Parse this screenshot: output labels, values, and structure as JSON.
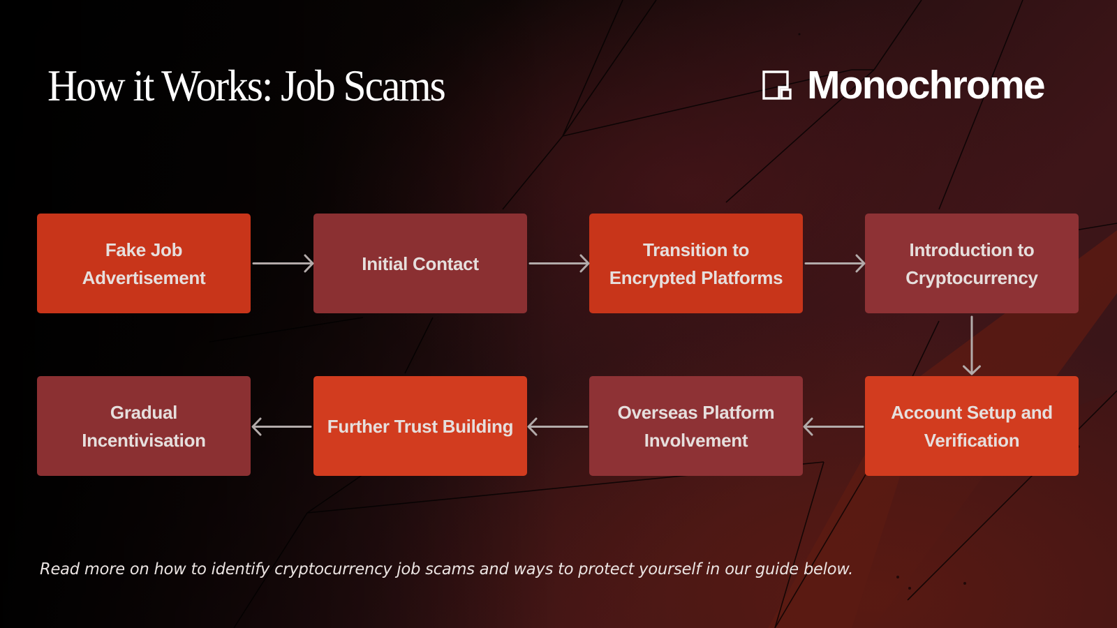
{
  "header": {
    "title": "How it Works: Job Scams",
    "brand": {
      "name": "Monochrome",
      "icon": "monochrome-logo-icon"
    }
  },
  "flow": {
    "direction": "snake: left-to-right on top row, down, right-to-left on bottom row",
    "steps": [
      {
        "id": 1,
        "label": "Fake Job Advertisement",
        "style": "orange",
        "row": "top"
      },
      {
        "id": 2,
        "label": "Initial Contact",
        "style": "maroon",
        "row": "top"
      },
      {
        "id": 3,
        "label": "Transition to Encrypted Platforms",
        "style": "orange",
        "row": "top"
      },
      {
        "id": 4,
        "label": "Introduction to Cryptocurrency",
        "style": "maroon",
        "row": "top"
      },
      {
        "id": 5,
        "label": "Account Setup and Verification",
        "style": "orange",
        "row": "bottom"
      },
      {
        "id": 6,
        "label": "Overseas Platform Involvement",
        "style": "maroon",
        "row": "bottom"
      },
      {
        "id": 7,
        "label": "Further Trust Building",
        "style": "orange",
        "row": "bottom"
      },
      {
        "id": 8,
        "label": "Gradual Incentivisation",
        "style": "maroon",
        "row": "bottom"
      }
    ],
    "arrows": [
      {
        "from": 1,
        "to": 2,
        "direction": "right"
      },
      {
        "from": 2,
        "to": 3,
        "direction": "right"
      },
      {
        "from": 3,
        "to": 4,
        "direction": "right"
      },
      {
        "from": 4,
        "to": 5,
        "direction": "down"
      },
      {
        "from": 5,
        "to": 6,
        "direction": "left"
      },
      {
        "from": 6,
        "to": 7,
        "direction": "left"
      },
      {
        "from": 7,
        "to": 8,
        "direction": "left"
      }
    ]
  },
  "footer": {
    "note": "Read more on how to identify cryptocurrency job scams and ways to protect yourself in our guide below."
  },
  "colors": {
    "orange": "#c8351a",
    "maroon": "#8b3032",
    "arrow": "#b3abaa",
    "text": "#e6dfdd",
    "background": "#050303"
  }
}
